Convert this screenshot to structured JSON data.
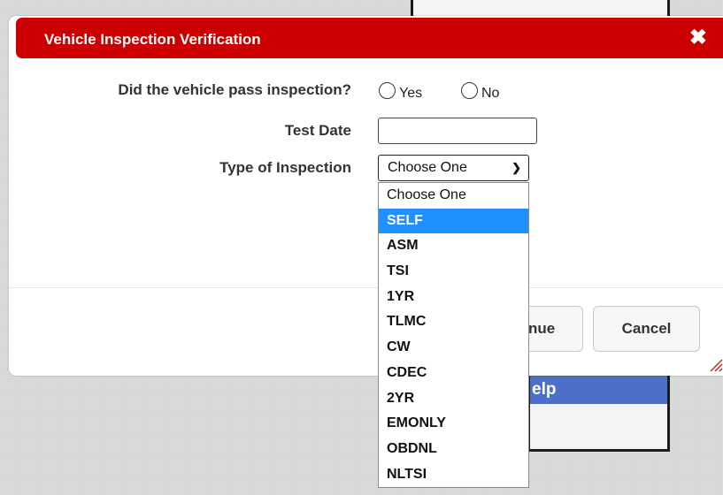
{
  "dialog": {
    "title": "Vehicle Inspection Verification",
    "close_symbol": "✖",
    "pass_label": "Did the vehicle pass inspection?",
    "yes_label": "Yes",
    "no_label": "No",
    "test_date_label": "Test Date",
    "test_date_value": "",
    "type_label": "Type of Inspection",
    "type_selected": "Choose One",
    "continue_label": "nue",
    "cancel_label": "Cancel"
  },
  "background": {
    "help_label": "elp"
  },
  "dropdown": {
    "highlighted_index": 1,
    "options": [
      "Choose One",
      "SELF",
      "ASM",
      "TSI",
      "1YR",
      "TLMC",
      "CW",
      "CDEC",
      "2YR",
      "EMONLY",
      "OBDNL",
      "NLTSI"
    ]
  },
  "colors": {
    "titlebar": "#cc0000",
    "highlight": "#1e90ff",
    "help_button": "#4e6fc7"
  }
}
